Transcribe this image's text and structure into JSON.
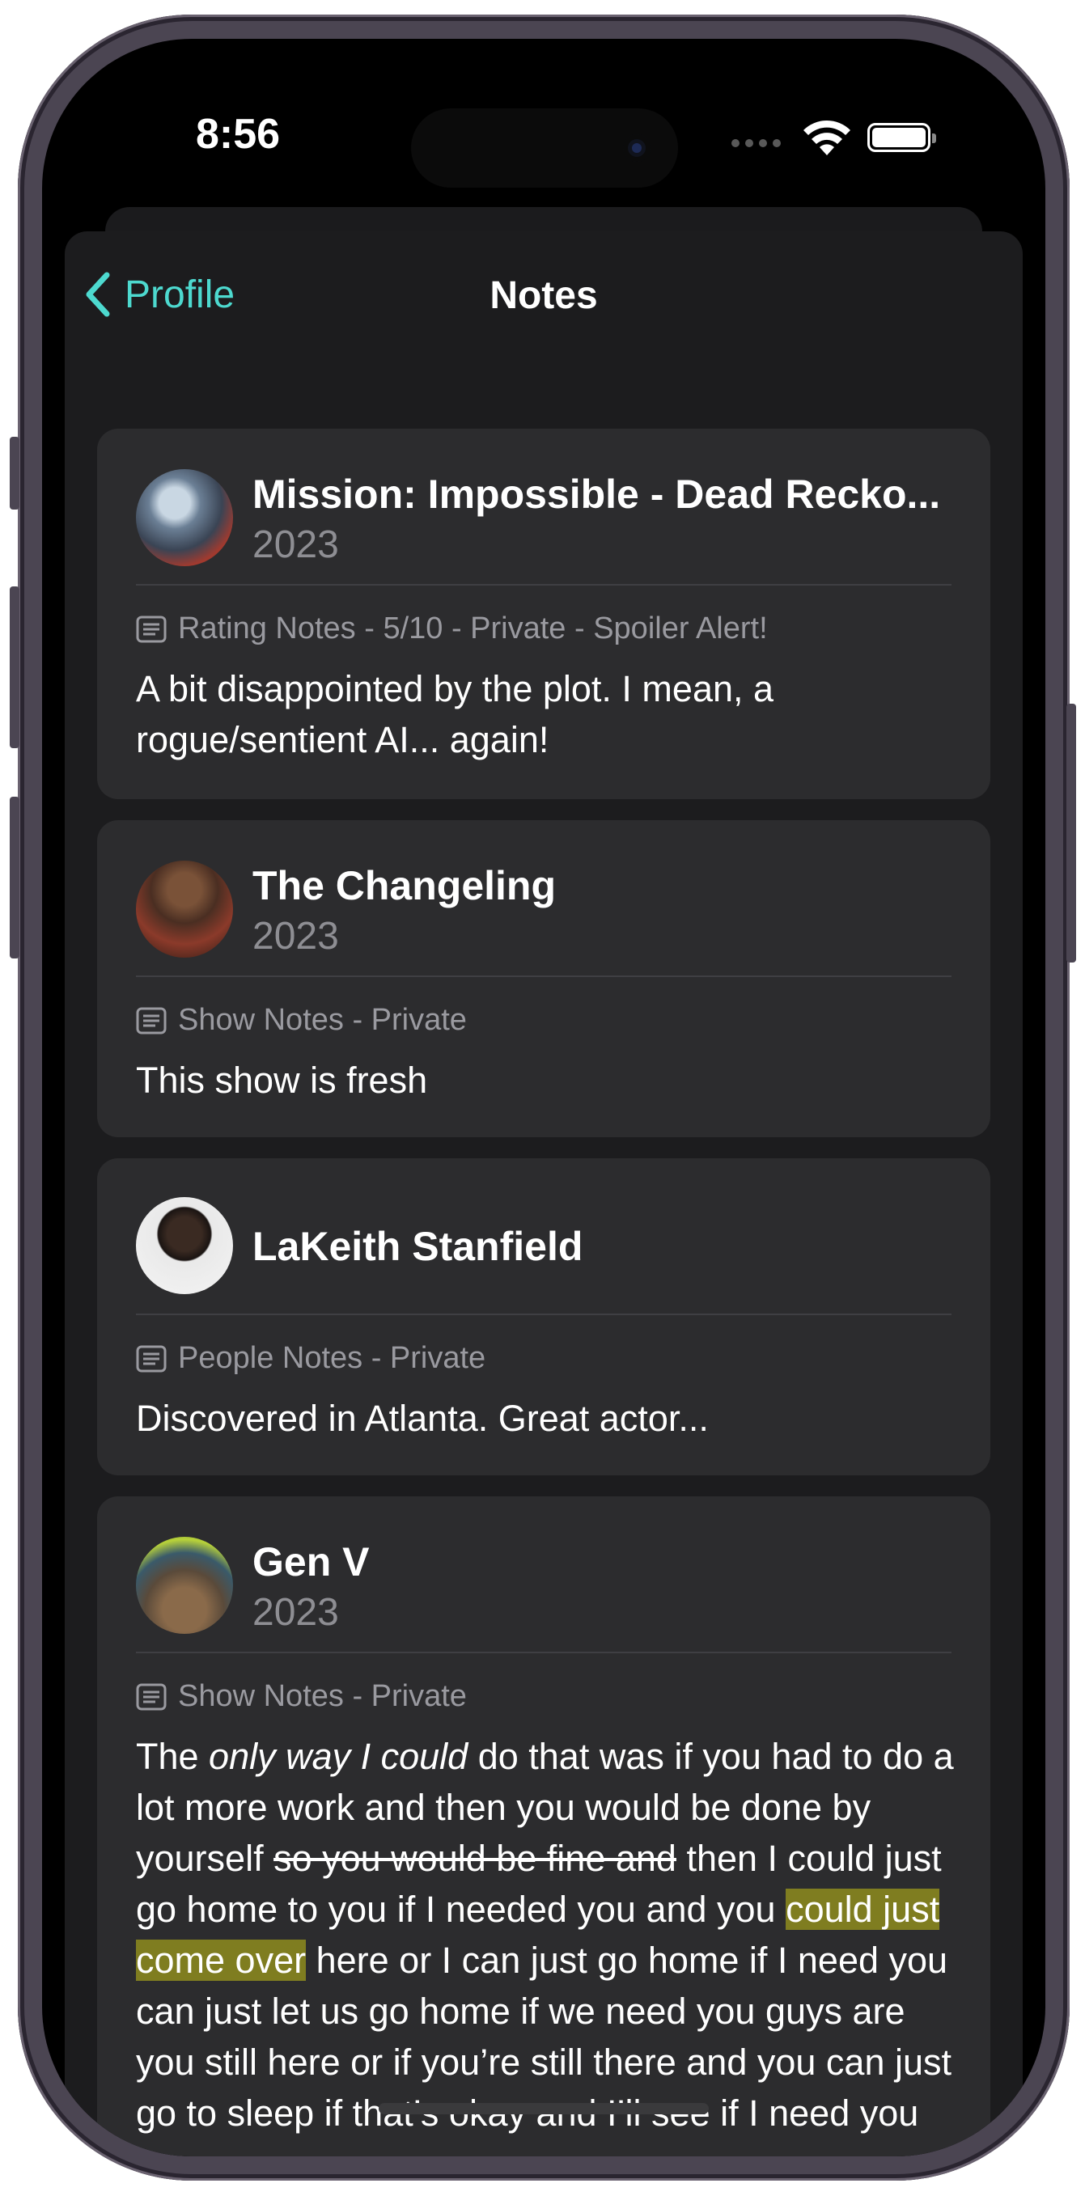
{
  "status_bar": {
    "time": "8:56",
    "icons": [
      "cellular-dots-icon",
      "wifi-icon",
      "battery-icon"
    ]
  },
  "nav": {
    "back_label": "Profile",
    "title": "Notes",
    "back_icon": "chevron-left-icon"
  },
  "colors": {
    "accent": "#4dd9cf",
    "background": "#1c1c1e",
    "card": "#2c2c2e",
    "highlight": "#7f7d20"
  },
  "notes": [
    {
      "title": "Mission: Impossible - Dead Recko...",
      "year": "2023",
      "meta": "Rating Notes - 5/10 - Private - Spoiler Alert!",
      "text_line1": "A bit disappointed by the plot. I mean, a",
      "text_line2": "rogue/sentient AI... again!"
    },
    {
      "title": "The Changeling",
      "year": "2023",
      "meta": "Show Notes - Private",
      "text": "This show is fresh"
    },
    {
      "title": "LaKeith Stanfield",
      "meta": "People Notes - Private",
      "text": "Discovered in Atlanta. Great actor..."
    },
    {
      "title": "Gen V",
      "year": "2023",
      "meta": "Show Notes - Private",
      "text_parts": {
        "p1": "The ",
        "p2_italic": "only way I could",
        "p3": " do that was if you had to do a lot more work and then you would be done by yourself ",
        "p4_strike": "so you would be fine and",
        "p5": " then I could just go home to you if I needed you and you ",
        "p6_highlight": "could just come over",
        "p7": " here or I can just go home if I need you can just let us go home if we need you guys are you still here or if you’re still there and you can just go to sleep if that’s okay and I’ll see if I need you"
      }
    }
  ]
}
